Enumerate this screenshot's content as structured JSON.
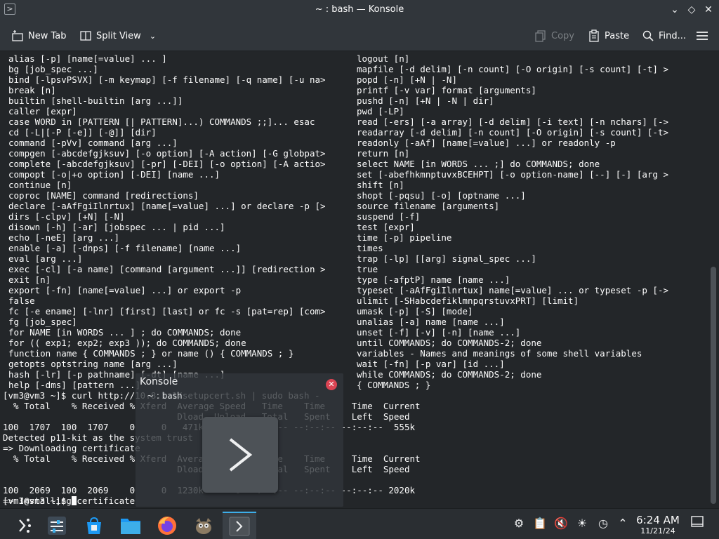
{
  "window": {
    "title": "~ : bash — Konsole"
  },
  "toolbar": {
    "new_tab": "New Tab",
    "split_view": "Split View",
    "copy": "Copy",
    "paste": "Paste",
    "find": "Find..."
  },
  "terminal": {
    "left_lines": [
      "alias [-p] [name[=value] ... ]",
      "bg [job_spec ...]",
      "bind [-lpsvPSVX] [-m keymap] [-f filename] [-q name] [-u na>",
      "break [n]",
      "builtin [shell-builtin [arg ...]]",
      "caller [expr]",
      "case WORD in [PATTERN [| PATTERN]...) COMMANDS ;;]... esac",
      "cd [-L|[-P [-e]] [-@]] [dir]",
      "command [-pVv] command [arg ...]",
      "compgen [-abcdefgjksuv] [-o option] [-A action] [-G globpat>",
      "complete [-abcdefgjksuv] [-pr] [-DEI] [-o option] [-A actio>",
      "compopt [-o|+o option] [-DEI] [name ...]",
      "continue [n]",
      "coproc [NAME] command [redirections]",
      "declare [-aAfFgiIlnrtux] [name[=value] ...] or declare -p [>",
      "dirs [-clpv] [+N] [-N]",
      "disown [-h] [-ar] [jobspec ... | pid ...]",
      "echo [-neE] [arg ...]",
      "enable [-a] [-dnps] [-f filename] [name ...]",
      "eval [arg ...]",
      "exec [-cl] [-a name] [command [argument ...]] [redirection >",
      "exit [n]",
      "export [-fn] [name[=value] ...] or export -p",
      "false",
      "fc [-e ename] [-lnr] [first] [last] or fc -s [pat=rep] [com>",
      "fg [job_spec]",
      "for NAME [in WORDS ... ] ; do COMMANDS; done",
      "for (( exp1; exp2; exp3 )); do COMMANDS; done",
      "function name { COMMANDS ; } or name () { COMMANDS ; }",
      "getopts optstring name [arg ...]",
      "hash [-lr] [-p pathname] [-dt] [name ...]",
      "help [-dms] [pattern ...]"
    ],
    "right_lines": [
      "logout [n]",
      "mapfile [-d delim] [-n count] [-O origin] [-s count] [-t] >",
      "popd [-n] [+N | -N]",
      "printf [-v var] format [arguments]",
      "pushd [-n] [+N | -N | dir]",
      "pwd [-LP]",
      "read [-ers] [-a array] [-d delim] [-i text] [-n nchars] [->",
      "readarray [-d delim] [-n count] [-O origin] [-s count] [-t>",
      "readonly [-aAf] [name[=value] ...] or readonly -p",
      "return [n]",
      "select NAME [in WORDS ... ;] do COMMANDS; done",
      "set [-abefhkmnptuvxBCEHPT] [-o option-name] [--] [-] [arg >",
      "shift [n]",
      "shopt [-pqsu] [-o] [optname ...]",
      "source filename [arguments]",
      "suspend [-f]",
      "test [expr]",
      "time [-p] pipeline",
      "times",
      "trap [-lp] [[arg] signal_spec ...]",
      "true",
      "type [-afptP] name [name ...]",
      "typeset [-aAfFgiIlnrtux] name[=value] ... or typeset -p [->",
      "ulimit [-SHabcdefiklmnpqrstuvxPRT] [limit]",
      "umask [-p] [-S] [mode]",
      "unalias [-a] name [name ...]",
      "unset [-f] [-v] [-n] [name ...]",
      "until COMMANDS; do COMMANDS-2; done",
      "variables - Names and meanings of some shell variables",
      "wait [-fn] [-p var] [id ...]",
      "while COMMANDS; do COMMANDS-2; done",
      "{ COMMANDS ; }"
    ],
    "session_lines": [
      "[vm3@vm3 ~]$ curl http://10.8.1.1/setupcert.sh | sudo bash -",
      "  % Total    % Received % Xferd  Average Speed   Time    Time     Time  Current",
      "                                 Dload  Upload   Total   Spent    Left  Speed",
      "100  1707  100  1707    0     0   471k      0 --:--:-- --:--:-- --:--:--  555k",
      "Detected p11-kit as the system trust",
      "=> Downloading certificate",
      "  % Total    % Received % Xferd  Average Speed   Time    Time     Time  Current",
      "                                 Dload  Upload   Total   Spent    Left  Speed",
      "",
      "100  2069  100  2069    0     0  1230k      0 --:--:-- --:--:-- --:--:-- 2020k",
      "=> Installing certificate"
    ],
    "prompt": "[vm3@vm3 ~]$ "
  },
  "notification": {
    "title": "Konsole",
    "subtitle": "~ : bash"
  },
  "taskbar": {
    "apps": [
      {
        "name": "application-launcher",
        "active": false
      },
      {
        "name": "system-settings",
        "active": false
      },
      {
        "name": "discover",
        "active": false
      },
      {
        "name": "dolphin",
        "active": false
      },
      {
        "name": "firefox",
        "active": false
      },
      {
        "name": "gimp",
        "active": false
      },
      {
        "name": "konsole",
        "active": true
      }
    ],
    "clock_time": "6:24 AM",
    "clock_date": "11/21/24"
  }
}
